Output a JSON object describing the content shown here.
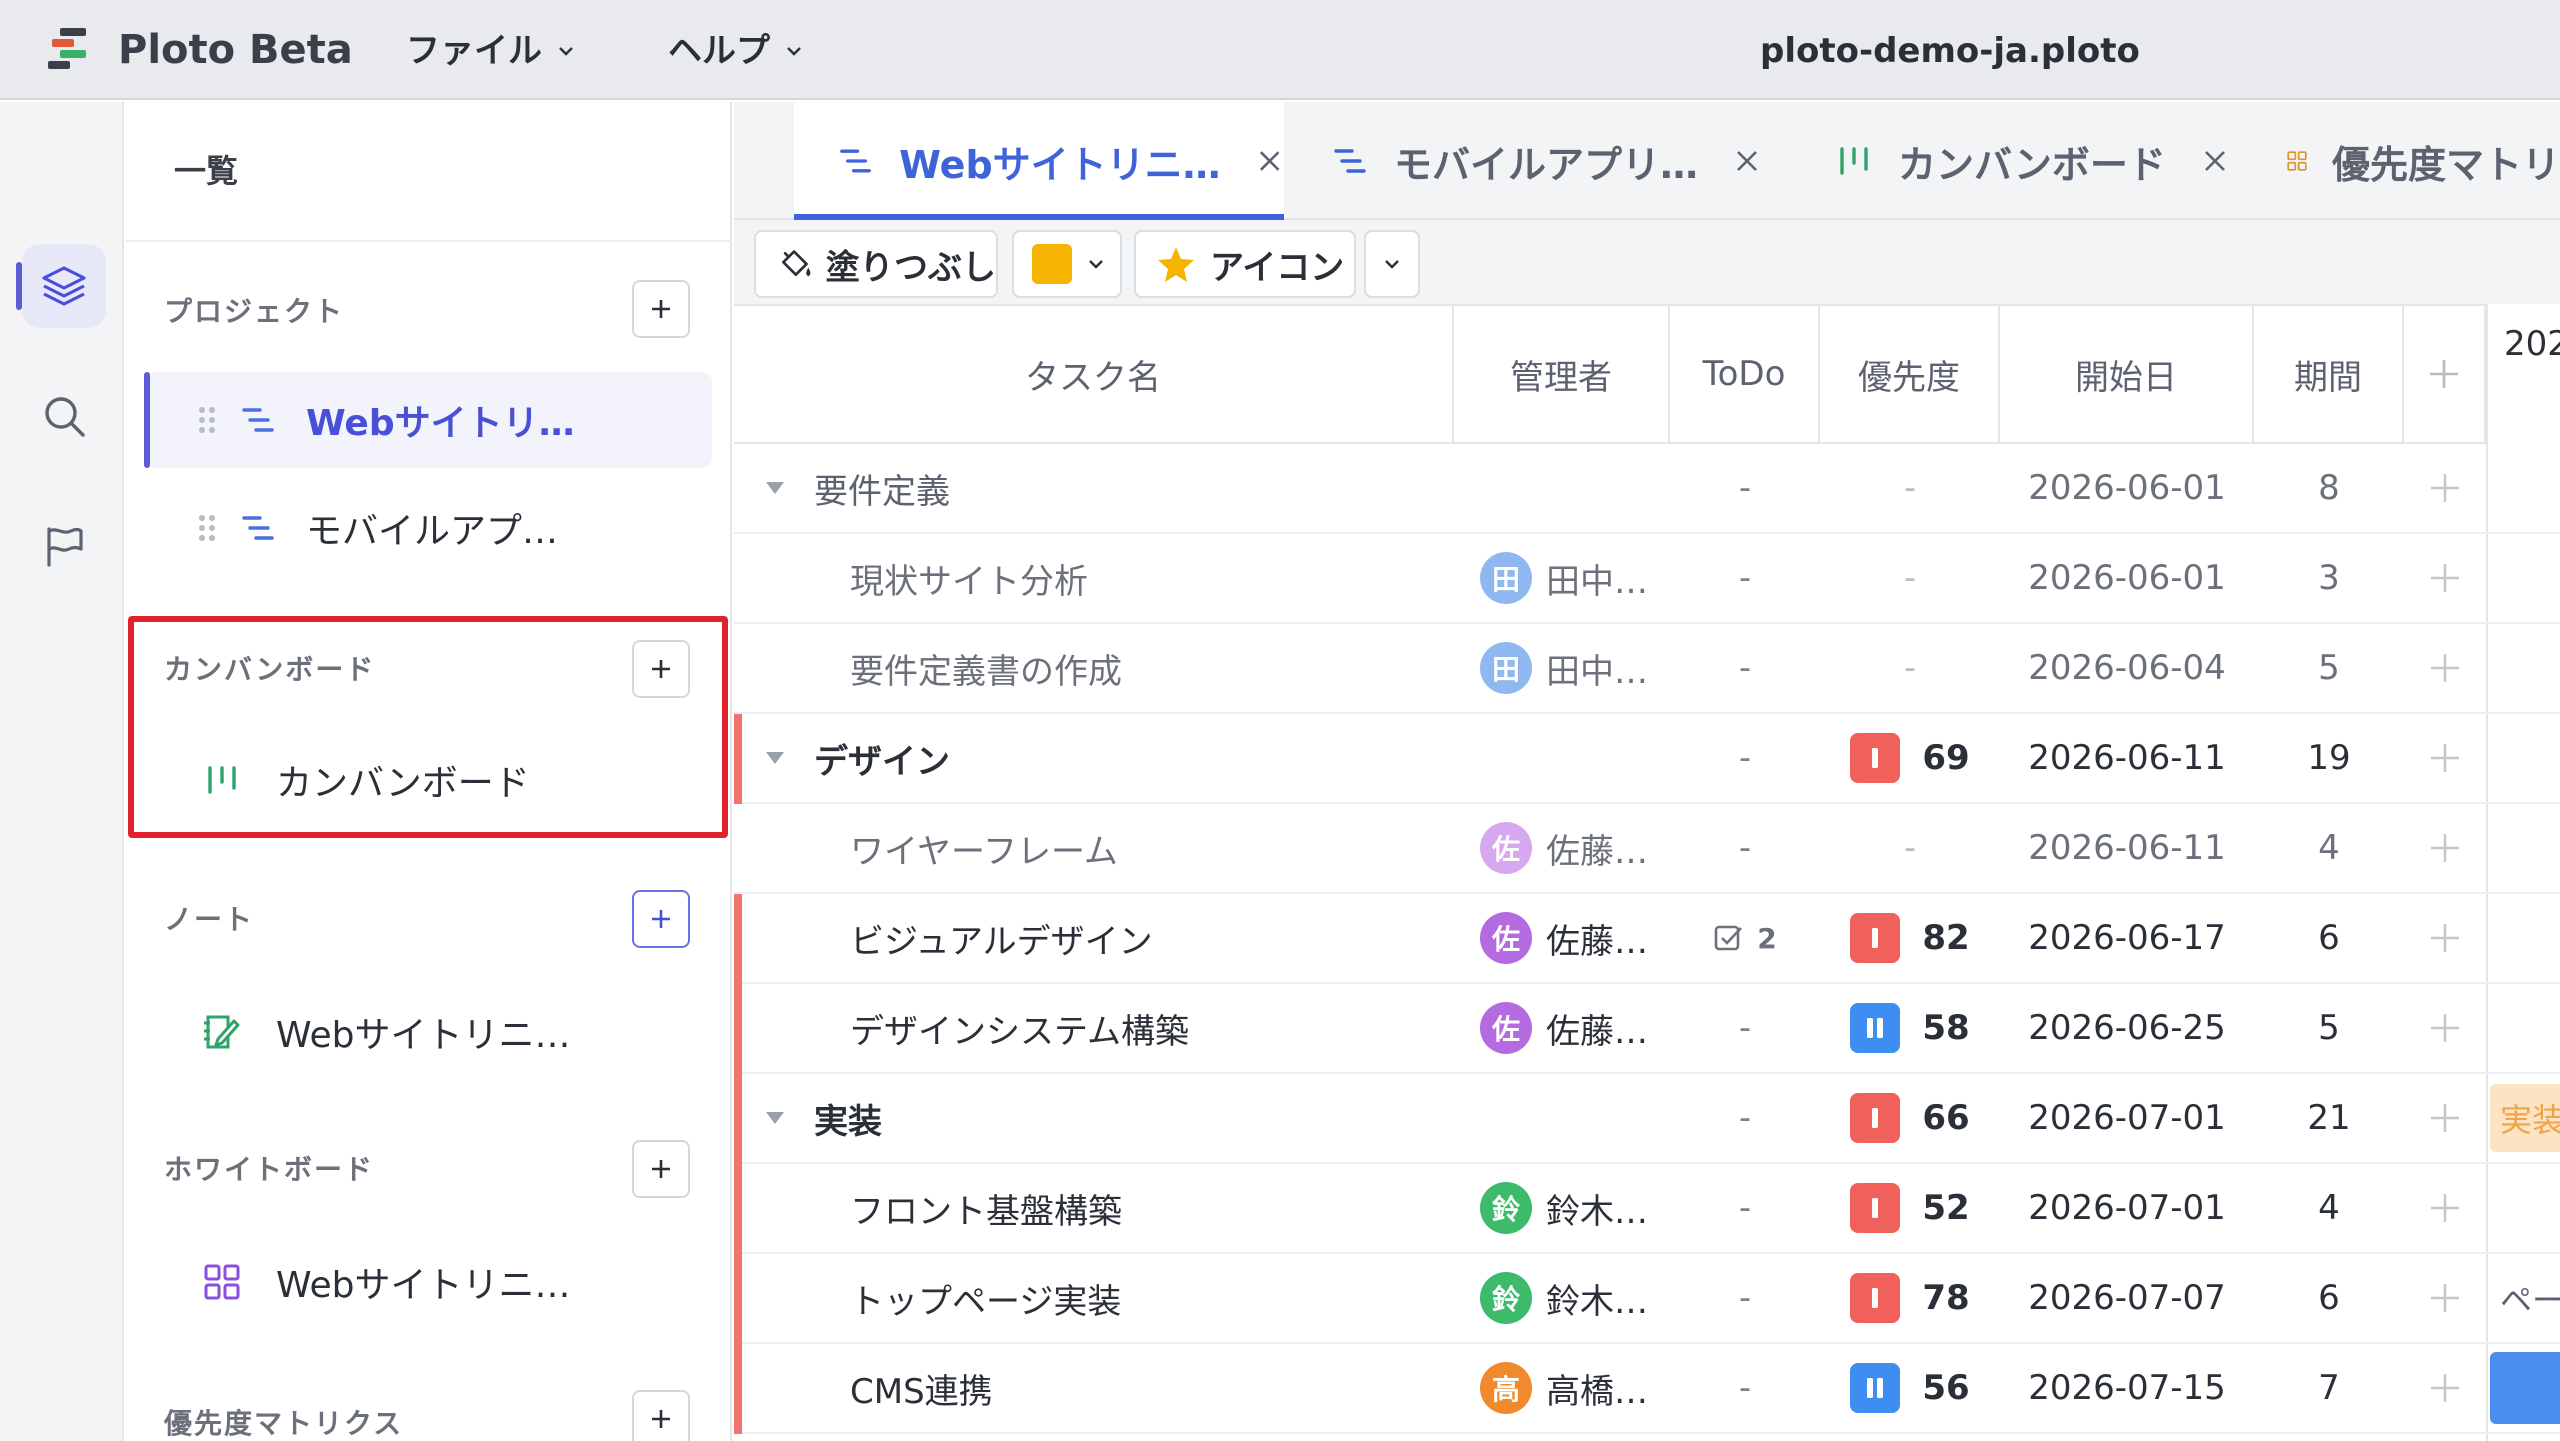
{
  "app": {
    "name": "Ploto Beta",
    "document_title": "ploto-demo-ja.ploto"
  },
  "menus": [
    {
      "label": "ファイル"
    },
    {
      "label": "ヘルプ"
    }
  ],
  "rail": {
    "items": [
      "layers-icon",
      "search-icon",
      "flag-icon"
    ],
    "active": "layers-icon"
  },
  "sidebar": {
    "header": "一覧",
    "sections": {
      "projects": {
        "title": "プロジェクト",
        "items": [
          {
            "label": "Webサイトリ…",
            "active": true
          },
          {
            "label": "モバイルアプ…"
          }
        ]
      },
      "kanban": {
        "title": "カンバンボード",
        "items": [
          {
            "label": "カンバンボード"
          }
        ]
      },
      "notes": {
        "title": "ノート",
        "items": [
          {
            "label": "Webサイトリニ…"
          }
        ]
      },
      "whiteboard": {
        "title": "ホワイトボード",
        "items": [
          {
            "label": "Webサイトリニ…"
          }
        ]
      },
      "matrix": {
        "title": "優先度マトリクス"
      }
    }
  },
  "tabs": [
    {
      "label": "Webサイトリニ…",
      "icon": "gantt-icon",
      "active": true
    },
    {
      "label": "モバイルアプリ…",
      "icon": "gantt-icon"
    },
    {
      "label": "カンバンボード",
      "icon": "kanban-icon"
    },
    {
      "label": "優先度マトリ",
      "icon": "matrix-icon"
    }
  ],
  "toolbar": {
    "fill_label": "塗りつぶし",
    "fill_color": "#f5b400",
    "icon_label": "アイコン"
  },
  "table": {
    "columns": [
      "タスク名",
      "管理者",
      "ToDo",
      "優先度",
      "開始日",
      "期間"
    ],
    "gantt_year": "202",
    "rows": [
      {
        "kind": "group",
        "style": "muted",
        "name": "要件定義",
        "todo": "-",
        "pri": "-",
        "start": "2026-06-01",
        "dur": "8"
      },
      {
        "kind": "sub",
        "name": "現状サイト分析",
        "avatar": "田",
        "avatar_color": "#8fb8f0",
        "mgr": "田中…",
        "todo": "-",
        "pri": "-",
        "start": "2026-06-01",
        "dur": "3"
      },
      {
        "kind": "sub",
        "name": "要件定義書の作成",
        "avatar": "田",
        "avatar_color": "#8fb8f0",
        "mgr": "田中…",
        "todo": "-",
        "pri": "-",
        "start": "2026-06-04",
        "dur": "5"
      },
      {
        "kind": "group",
        "bar": true,
        "name": "デザイン",
        "todo": "-",
        "pri_kind": "high",
        "pri": "69",
        "start": "2026-06-11",
        "dur": "19"
      },
      {
        "kind": "sub",
        "name": "ワイヤーフレーム",
        "avatar": "佐",
        "avatar_color": "#d6a8f0",
        "mgr": "佐藤…",
        "todo": "-",
        "pri": "-",
        "start": "2026-06-11",
        "dur": "4"
      },
      {
        "kind": "sub",
        "strong": true,
        "bar": true,
        "name": "ビジュアルデザイン",
        "avatar": "佐",
        "avatar_color": "#b56be0",
        "mgr": "佐藤…",
        "todo_count": "2",
        "pri_kind": "high",
        "pri": "82",
        "start": "2026-06-17",
        "dur": "6"
      },
      {
        "kind": "sub",
        "strong": true,
        "bar": true,
        "name": "デザインシステム構築",
        "avatar": "佐",
        "avatar_color": "#b56be0",
        "mgr": "佐藤…",
        "todo": "-",
        "pri_kind": "mid",
        "pri": "58",
        "start": "2026-06-25",
        "dur": "5"
      },
      {
        "kind": "group",
        "bar": true,
        "name": "実装",
        "todo": "-",
        "pri_kind": "high",
        "pri": "66",
        "start": "2026-07-01",
        "dur": "21",
        "gantt_label": "実装"
      },
      {
        "kind": "sub",
        "strong": true,
        "bar": true,
        "name": "フロント基盤構築",
        "avatar": "鈴",
        "avatar_color": "#3dbb6b",
        "mgr": "鈴木…",
        "todo": "-",
        "pri_kind": "high",
        "pri": "52",
        "start": "2026-07-01",
        "dur": "4"
      },
      {
        "kind": "sub",
        "strong": true,
        "bar": true,
        "name": "トップページ実装",
        "avatar": "鈴",
        "avatar_color": "#3dbb6b",
        "mgr": "鈴木…",
        "todo": "-",
        "pri_kind": "high",
        "pri": "78",
        "start": "2026-07-07",
        "dur": "6",
        "gantt_label": "ペー"
      },
      {
        "kind": "sub",
        "strong": true,
        "bar": true,
        "name": "CMS連携",
        "avatar": "高",
        "avatar_color": "#f08a2c",
        "mgr": "高橋…",
        "todo": "-",
        "pri_kind": "mid",
        "pri": "56",
        "start": "2026-07-15",
        "dur": "7"
      }
    ]
  },
  "colors": {
    "accent": "#5b5bd6",
    "tab_active": "#3f63d8",
    "priority_high": "#f0615c",
    "priority_mid": "#3d8ef0",
    "highlight": "#e0222a"
  }
}
